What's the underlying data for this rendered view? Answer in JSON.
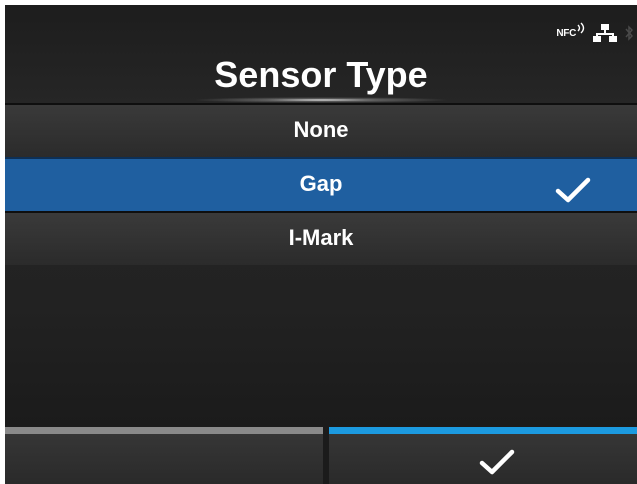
{
  "screen": {
    "title": "Sensor Type"
  },
  "status_bar": {
    "nfc_label": "NFC",
    "icons": [
      "nfc-icon",
      "network-icon",
      "bluetooth-icon"
    ]
  },
  "options": [
    {
      "label": "None",
      "selected": false
    },
    {
      "label": "Gap",
      "selected": true
    },
    {
      "label": "I-Mark",
      "selected": false
    }
  ],
  "footer": {
    "left_button": {
      "icon": null
    },
    "right_button": {
      "icon": "check-icon"
    }
  },
  "colors": {
    "background": "#222222",
    "selected_row": "#1f5fa0",
    "confirm_accent": "#1c9ae0",
    "cancel_accent": "#8a8a8a",
    "text": "#ffffff"
  }
}
